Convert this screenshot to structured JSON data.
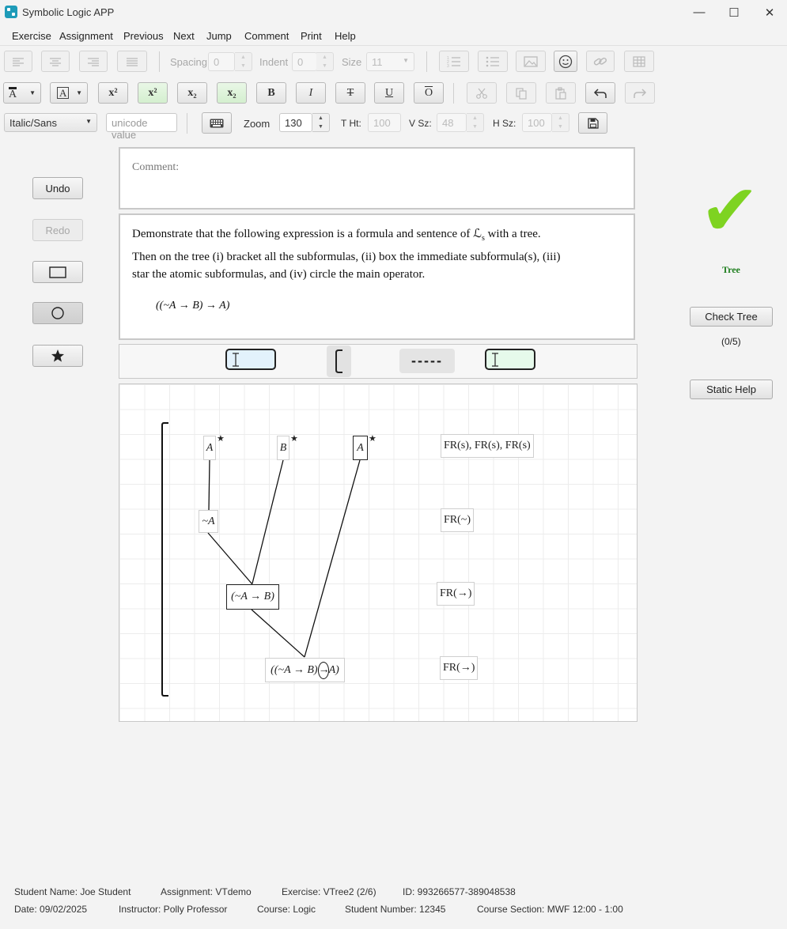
{
  "window": {
    "title": "Symbolic Logic APP",
    "minimize": "—",
    "maximize": "☐",
    "close": "✕"
  },
  "menu": [
    "Exercise",
    "Assignment",
    "Previous",
    "Next",
    "Jump",
    "Comment",
    "Print",
    "Help"
  ],
  "toolbar1": {
    "spacing_label": "Spacing",
    "spacing_value": "0",
    "indent_label": "Indent",
    "indent_value": "0",
    "size_label": "Size",
    "size_value": "11"
  },
  "toolbar2": {
    "text_color": "A",
    "highlight": "A",
    "superscript": "x²",
    "superscript2": "x²",
    "subscript": "x₂",
    "subscript2": "x₂",
    "bold": "B",
    "italic": "I",
    "strike": "T",
    "underline": "U",
    "overline": "O"
  },
  "toolbar3": {
    "font_select": "Italic/Sans",
    "unicode_placeholder": "unicode value",
    "zoom_label": "Zoom",
    "zoom_value": "130",
    "theight_label": "T Ht:",
    "theight_value": "100",
    "vsize_label": "V Sz:",
    "vsize_value": "48",
    "hsize_label": "H Sz:",
    "hsize_value": "100"
  },
  "left_buttons": {
    "undo": "Undo",
    "redo": "Redo"
  },
  "comment_label": "Comment:",
  "exercise": {
    "line1": "Demonstrate that the following expression is a formula and sentence of ℒ",
    "line1_sub": "s",
    "line1_end": " with a tree.",
    "line2": "Then on the tree (i) bracket all the subformulas, (ii) box the immediate subformula(s), (iii)",
    "line3": "star the atomic subformulas, and (iv) circle the main operator.",
    "formula": "((~A → B) → A)"
  },
  "tree": {
    "dashes": "-----",
    "nodes": {
      "n1": "A",
      "n2": "B",
      "n3": "A",
      "n4": "~A",
      "n5": "(~A → B)",
      "n6a": "((~A → B)",
      "n6op": "→",
      "n6b": "A)"
    },
    "star": "★",
    "rules": {
      "r1": "FR(s), FR(s), FR(s)",
      "r2": "FR(~)",
      "r3": "FR(→)",
      "r4": "FR(→)"
    }
  },
  "right": {
    "check_mark": "✔",
    "tree_label": "Tree",
    "check_button": "Check Tree",
    "score": "(0/5)",
    "help_button": "Static Help",
    "colors": {
      "check": "#7ed321",
      "tree_label": "#1e7e1e"
    }
  },
  "status": {
    "student_name": "Student Name: Joe Student",
    "assignment": "Assignment: VTdemo",
    "exercise": "Exercise: VTree2 (2/6)",
    "id": "ID: 993266577-389048538",
    "date": "Date: 09/02/2025",
    "instructor": "Instructor: Polly Professor",
    "course": "Course: Logic",
    "student_number": "Student Number: 12345",
    "section": "Course Section: MWF 12:00 - 1:00"
  }
}
